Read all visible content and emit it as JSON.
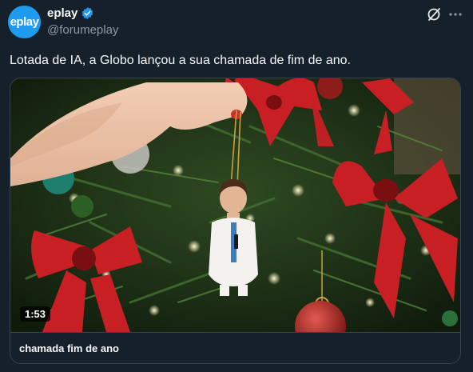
{
  "author": {
    "avatar_text": "eplay",
    "display_name": "eplay",
    "handle": "@forumeplay",
    "verified": true
  },
  "icons": {
    "verified": "verified-badge-icon",
    "grok": "grok-icon",
    "more": "more-options-icon"
  },
  "colors": {
    "background": "#15202b",
    "accent": "#1d9bf0",
    "secondary_text": "#8b98a5"
  },
  "tweet": {
    "text": "Lotada de IA, a Globo lançou a sua chamada de fim de ano."
  },
  "media_card": {
    "duration": "1:53",
    "title": "chamada fim de ano"
  }
}
